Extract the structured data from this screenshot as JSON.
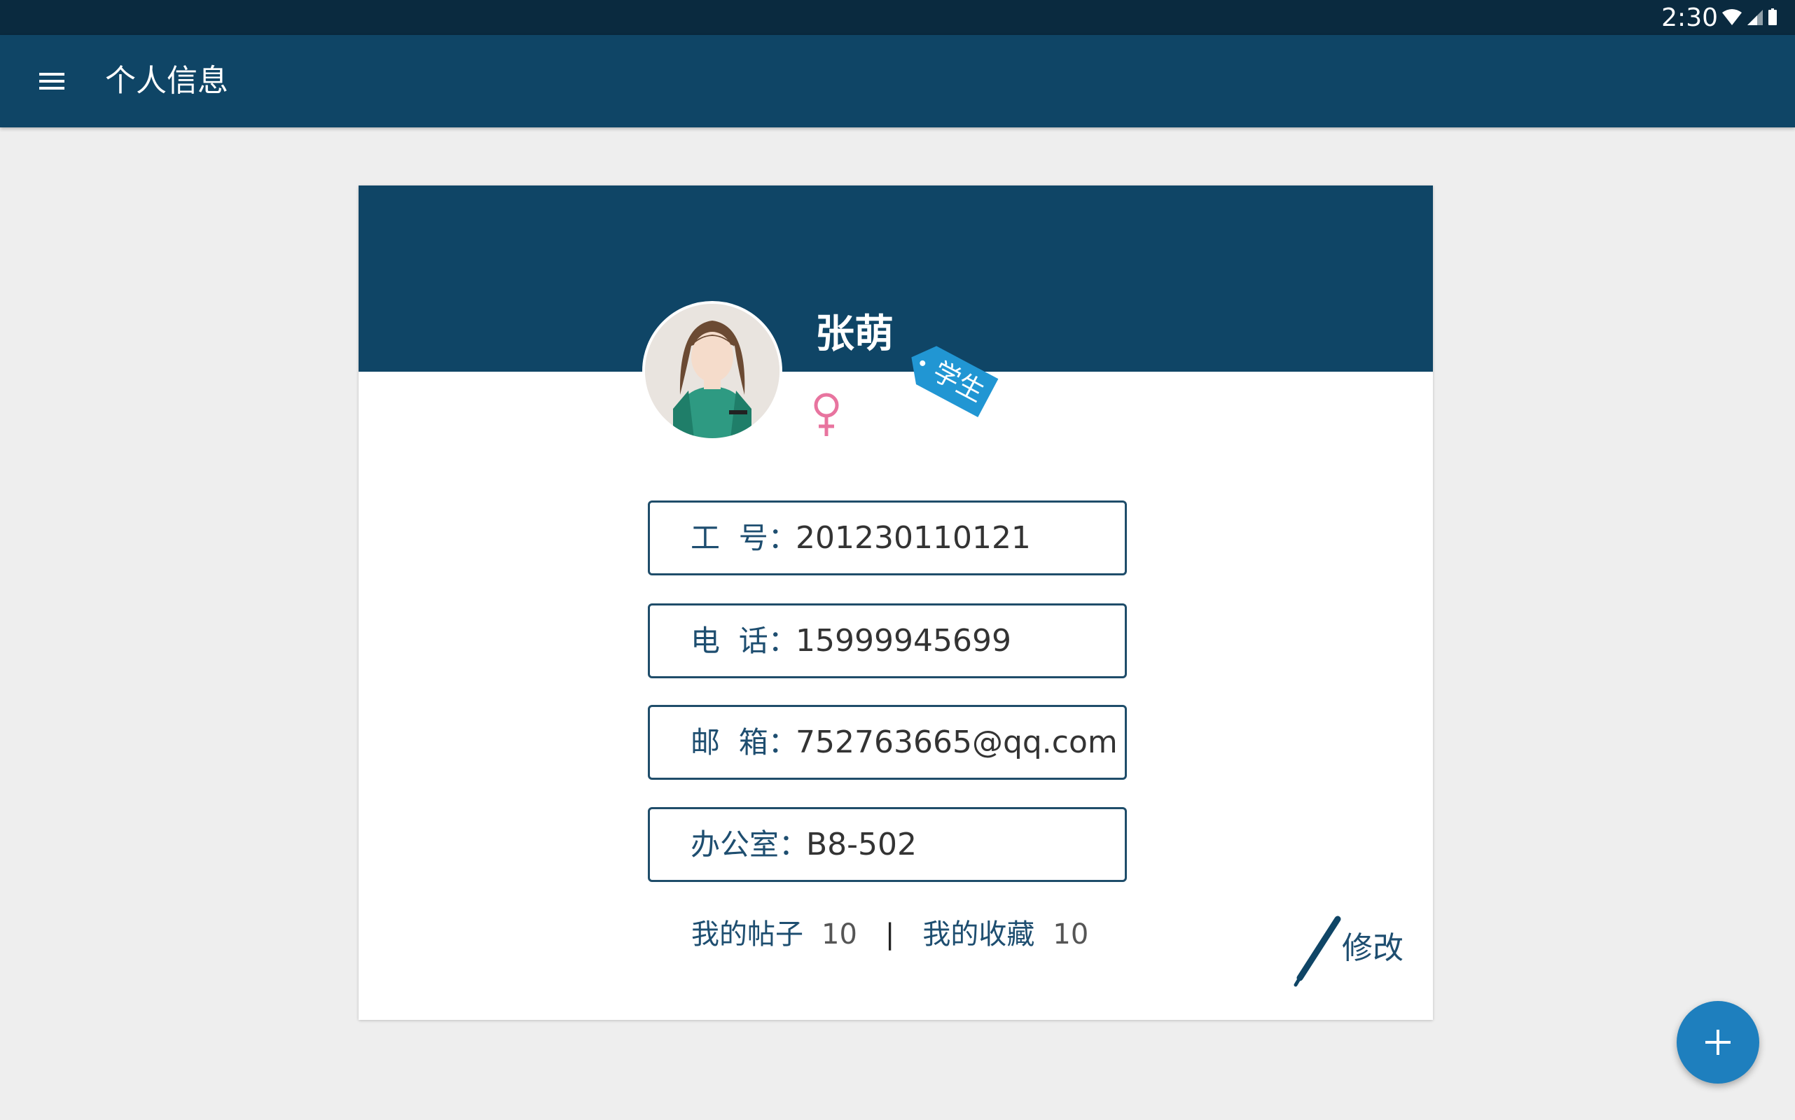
{
  "status_bar": {
    "time": "2:30",
    "icons": [
      "wifi-icon",
      "signal-icon",
      "battery-icon"
    ]
  },
  "app_bar": {
    "title": "个人信息",
    "menu_icon": "menu-icon"
  },
  "profile": {
    "name": "张萌",
    "role_tag": "学生",
    "gender_icon": "female-symbol-icon",
    "gender_color": "#e8749f"
  },
  "fields": [
    {
      "label": "工  号：",
      "value": "201230110121"
    },
    {
      "label": "电  话：",
      "value": "15999945699"
    },
    {
      "label": "邮  箱：",
      "value": "752763665@qq.com"
    },
    {
      "label": "办公室：",
      "value": "B8-502"
    }
  ],
  "stats": {
    "posts_label": "我的帖子",
    "posts_count": "10",
    "separator": "|",
    "favorites_label": "我的收藏",
    "favorites_count": "10"
  },
  "edit_button": {
    "label": "修改",
    "icon": "pen-icon"
  },
  "fab": {
    "icon": "plus-icon"
  },
  "colors": {
    "primary": "#0f4566",
    "status_bar": "#0a2a3f",
    "accent": "#1e7fbe",
    "tag": "#2196d3",
    "background": "#eeeeee"
  }
}
